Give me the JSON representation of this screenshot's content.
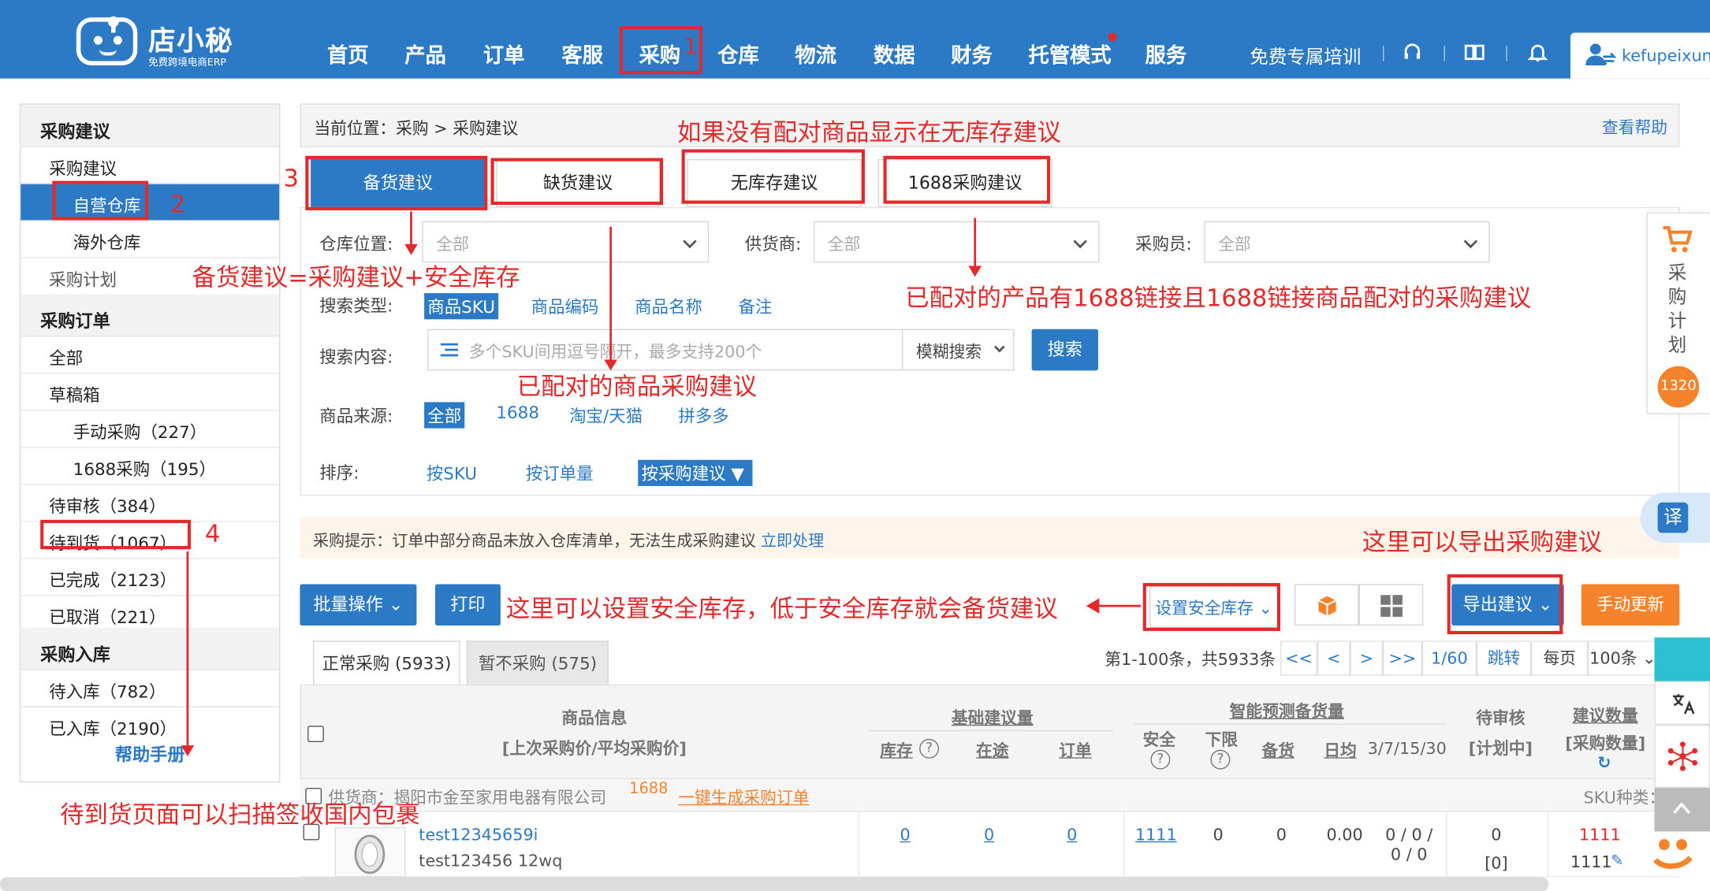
{
  "header": {
    "logo_name": "店小秘",
    "logo_sub": "免费跨境电商ERP",
    "nav": [
      "首页",
      "产品",
      "订单",
      "客服",
      "采购",
      "仓库",
      "物流",
      "数据",
      "财务",
      "托管模式",
      "服务"
    ],
    "training": "免费专属培训",
    "username": "kefupeixun"
  },
  "sidebar": {
    "sec1": "采购建议",
    "s1_items": [
      "采购建议",
      "自营仓库",
      "海外仓库",
      "采购计划"
    ],
    "sec2": "采购订单",
    "s2_items": [
      "全部",
      "草稿箱",
      "手动采购（227）",
      "1688采购（195）",
      "待审核（384）",
      "待到货（1067）",
      "已完成（2123）",
      "已取消（221）"
    ],
    "sec3": "采购入库",
    "s3_items": [
      "待入库（782）",
      "已入库（2190）"
    ],
    "help": "帮助手册"
  },
  "main": {
    "crumb": "当前位置：采购 > 采购建议",
    "help": "查看帮助",
    "tabs": [
      "备货建议",
      "缺货建议",
      "无库存建议",
      "1688采购建议"
    ],
    "filters": {
      "warehouse_label": "仓库位置:",
      "warehouse_value": "全部",
      "supplier_label": "供货商:",
      "supplier_value": "全部",
      "buyer_label": "采购员:",
      "buyer_value": "全部",
      "search_type_label": "搜索类型:",
      "search_types": [
        "商品SKU",
        "商品编码",
        "商品名称",
        "备注"
      ],
      "search_content_label": "搜索内容:",
      "search_placeholder": "多个SKU间用逗号隔开，最多支持200个",
      "fuzzy": "模糊搜索",
      "search_btn": "搜索",
      "source_label": "商品来源:",
      "sources": [
        "全部",
        "1688",
        "淘宝/天猫",
        "拼多多"
      ],
      "sort_label": "排序:",
      "sorts": [
        "按SKU",
        "按订单量",
        "按采购建议 ▼"
      ]
    },
    "tip": "采购提示：订单中部分商品未放入仓库清单，无法生成采购建议",
    "tip_link": "立即处理",
    "toolbar": {
      "batch": "批量操作",
      "print": "打印",
      "safety": "设置安全库存",
      "export": "导出建议",
      "manual": "手动更新"
    },
    "subtabs": [
      "正常采购 (5933)",
      "暂不采购 (575)"
    ],
    "pager": {
      "summary": "第1-100条，共5933条",
      "first": "<<",
      "prev": "<",
      "next": ">",
      "last": ">>",
      "page": "1/60",
      "jump": "跳转",
      "per_label": "每页",
      "per_value": "100条"
    },
    "table": {
      "h_product": "商品信息",
      "h_product_sub": "[上次采购价/平均采购价]",
      "h_basic": "基础建议量",
      "h_stock": "库存",
      "h_transit": "在途",
      "h_order": "订单",
      "h_smart": "智能预测备货量",
      "h_safe": "安全",
      "h_lower": "下限",
      "h_prep": "备货",
      "h_daily": "日均",
      "h_period": "3/7/15/30",
      "h_review": "待审核",
      "h_plan": "[计划中]",
      "h_suggest": "建议数量",
      "h_purchase": "[采购数量]",
      "supplier_text": "供货商：揭阳市金至家用电器有限公司",
      "supplier_tag": "1688",
      "one_click": "一键生成采购订单",
      "sku_kinds": "SKU种类：1",
      "row": {
        "sku": "test12345659i",
        "name": "test123456 12wq",
        "stock": "0",
        "transit": "0",
        "order": "0",
        "safe": "1111",
        "lower": "0",
        "prep": "0",
        "daily": "0.00",
        "period": "0 / 0 / 0 / 0",
        "review": "0",
        "plan": "[0]",
        "suggest": "1111",
        "purchase": "1111"
      }
    }
  },
  "float": {
    "plan": "采购计划",
    "badge": "1320",
    "translate": "译"
  },
  "annotations": {
    "n1": "1",
    "n2": "2",
    "n3": "3",
    "n4": "4",
    "a_nomatch": "如果没有配对商品显示在无库存建议",
    "a_prep": "备货建议=采购建议+安全库存",
    "a_1688": "已配对的产品有1688链接且1688链接商品配对的采购建议",
    "a_matched": "已配对的商品采购建议",
    "a_export": "这里可以导出采购建议",
    "a_safety": "这里可以设置安全库存，低于安全库存就会备货建议",
    "a_arrive": "待到货页面可以扫描签收国内包裹"
  },
  "colors": {
    "primary": "#2c7ac6",
    "accent": "#f5832b",
    "annotation": "#e32a2a"
  }
}
